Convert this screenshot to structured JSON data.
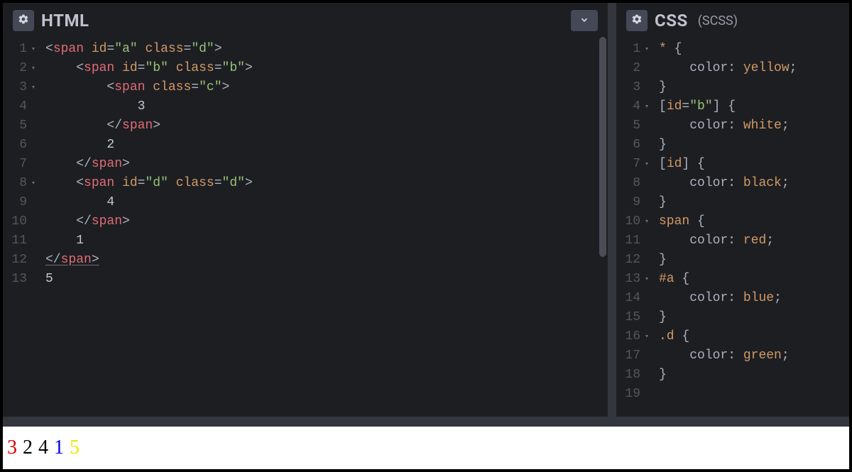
{
  "panels": {
    "html": {
      "title": "HTML",
      "subtitle": ""
    },
    "css": {
      "title": "CSS",
      "subtitle": "(SCSS)"
    }
  },
  "html_code": {
    "lines": [
      {
        "n": 1,
        "fold": true,
        "indent": 0,
        "tokens": [
          {
            "t": "<",
            "c": "punct"
          },
          {
            "t": "span",
            "c": "tag"
          },
          {
            "t": " ",
            "c": "plain"
          },
          {
            "t": "id",
            "c": "attrname"
          },
          {
            "t": "=",
            "c": "punct"
          },
          {
            "t": "\"a\"",
            "c": "attrvalue"
          },
          {
            "t": " ",
            "c": "plain"
          },
          {
            "t": "class",
            "c": "attrname"
          },
          {
            "t": "=",
            "c": "punct"
          },
          {
            "t": "\"d\"",
            "c": "attrvalue"
          },
          {
            "t": ">",
            "c": "punct"
          }
        ]
      },
      {
        "n": 2,
        "fold": true,
        "indent": 1,
        "tokens": [
          {
            "t": "<",
            "c": "punct"
          },
          {
            "t": "span",
            "c": "tag"
          },
          {
            "t": " ",
            "c": "plain"
          },
          {
            "t": "id",
            "c": "attrname"
          },
          {
            "t": "=",
            "c": "punct"
          },
          {
            "t": "\"b\"",
            "c": "attrvalue"
          },
          {
            "t": " ",
            "c": "plain"
          },
          {
            "t": "class",
            "c": "attrname"
          },
          {
            "t": "=",
            "c": "punct"
          },
          {
            "t": "\"b\"",
            "c": "attrvalue"
          },
          {
            "t": ">",
            "c": "punct"
          }
        ]
      },
      {
        "n": 3,
        "fold": true,
        "indent": 2,
        "tokens": [
          {
            "t": "<",
            "c": "punct"
          },
          {
            "t": "span",
            "c": "tag"
          },
          {
            "t": " ",
            "c": "plain"
          },
          {
            "t": "class",
            "c": "attrname"
          },
          {
            "t": "=",
            "c": "punct"
          },
          {
            "t": "\"c\"",
            "c": "attrvalue"
          },
          {
            "t": ">",
            "c": "punct"
          }
        ]
      },
      {
        "n": 4,
        "fold": false,
        "indent": 3,
        "tokens": [
          {
            "t": "3",
            "c": "plain"
          }
        ]
      },
      {
        "n": 5,
        "fold": false,
        "indent": 2,
        "tokens": [
          {
            "t": "</",
            "c": "punct"
          },
          {
            "t": "span",
            "c": "tag"
          },
          {
            "t": ">",
            "c": "punct"
          }
        ]
      },
      {
        "n": 6,
        "fold": false,
        "indent": 2,
        "tokens": [
          {
            "t": "2",
            "c": "plain"
          }
        ]
      },
      {
        "n": 7,
        "fold": false,
        "indent": 1,
        "tokens": [
          {
            "t": "</",
            "c": "punct"
          },
          {
            "t": "span",
            "c": "tag"
          },
          {
            "t": ">",
            "c": "punct"
          }
        ]
      },
      {
        "n": 8,
        "fold": true,
        "indent": 1,
        "tokens": [
          {
            "t": "<",
            "c": "punct"
          },
          {
            "t": "span",
            "c": "tag"
          },
          {
            "t": " ",
            "c": "plain"
          },
          {
            "t": "id",
            "c": "attrname"
          },
          {
            "t": "=",
            "c": "punct"
          },
          {
            "t": "\"d\"",
            "c": "attrvalue"
          },
          {
            "t": " ",
            "c": "plain"
          },
          {
            "t": "class",
            "c": "attrname"
          },
          {
            "t": "=",
            "c": "punct"
          },
          {
            "t": "\"d\"",
            "c": "attrvalue"
          },
          {
            "t": ">",
            "c": "punct"
          }
        ]
      },
      {
        "n": 9,
        "fold": false,
        "indent": 2,
        "tokens": [
          {
            "t": "4",
            "c": "plain"
          }
        ]
      },
      {
        "n": 10,
        "fold": false,
        "indent": 1,
        "tokens": [
          {
            "t": "</",
            "c": "punct"
          },
          {
            "t": "span",
            "c": "tag"
          },
          {
            "t": ">",
            "c": "punct"
          }
        ]
      },
      {
        "n": 11,
        "fold": false,
        "indent": 1,
        "tokens": [
          {
            "t": "1",
            "c": "plain"
          }
        ]
      },
      {
        "n": 12,
        "fold": false,
        "indent": 0,
        "underline": true,
        "tokens": [
          {
            "t": "</",
            "c": "punct"
          },
          {
            "t": "span",
            "c": "tag"
          },
          {
            "t": ">",
            "c": "punct"
          }
        ]
      },
      {
        "n": 13,
        "fold": false,
        "indent": 0,
        "tokens": [
          {
            "t": "5",
            "c": "plain"
          }
        ]
      }
    ]
  },
  "css_code": {
    "lines": [
      {
        "n": 1,
        "fold": true,
        "indent": 0,
        "tokens": [
          {
            "t": "*",
            "c": "selector"
          },
          {
            "t": " {",
            "c": "bracket"
          }
        ]
      },
      {
        "n": 2,
        "fold": false,
        "indent": 1,
        "tokens": [
          {
            "t": "color",
            "c": "prop"
          },
          {
            "t": ": ",
            "c": "punct"
          },
          {
            "t": "yellow",
            "c": "val-word"
          },
          {
            "t": ";",
            "c": "punct"
          }
        ]
      },
      {
        "n": 3,
        "fold": false,
        "indent": 0,
        "tokens": [
          {
            "t": "}",
            "c": "bracket"
          }
        ]
      },
      {
        "n": 4,
        "fold": true,
        "indent": 0,
        "tokens": [
          {
            "t": "[",
            "c": "bracket"
          },
          {
            "t": "id",
            "c": "selector"
          },
          {
            "t": "=",
            "c": "punct"
          },
          {
            "t": "\"b\"",
            "c": "attrvalue"
          },
          {
            "t": "]",
            "c": "bracket"
          },
          {
            "t": " {",
            "c": "bracket"
          }
        ]
      },
      {
        "n": 5,
        "fold": false,
        "indent": 1,
        "tokens": [
          {
            "t": "color",
            "c": "prop"
          },
          {
            "t": ": ",
            "c": "punct"
          },
          {
            "t": "white",
            "c": "val-word"
          },
          {
            "t": ";",
            "c": "punct"
          }
        ]
      },
      {
        "n": 6,
        "fold": false,
        "indent": 0,
        "tokens": [
          {
            "t": "}",
            "c": "bracket"
          }
        ]
      },
      {
        "n": 7,
        "fold": true,
        "indent": 0,
        "tokens": [
          {
            "t": "[",
            "c": "bracket"
          },
          {
            "t": "id",
            "c": "selector"
          },
          {
            "t": "]",
            "c": "bracket"
          },
          {
            "t": " {",
            "c": "bracket"
          }
        ]
      },
      {
        "n": 8,
        "fold": false,
        "indent": 1,
        "tokens": [
          {
            "t": "color",
            "c": "prop"
          },
          {
            "t": ": ",
            "c": "punct"
          },
          {
            "t": "black",
            "c": "val-word"
          },
          {
            "t": ";",
            "c": "punct"
          }
        ]
      },
      {
        "n": 9,
        "fold": false,
        "indent": 0,
        "tokens": [
          {
            "t": "}",
            "c": "bracket"
          }
        ]
      },
      {
        "n": 10,
        "fold": true,
        "indent": 0,
        "tokens": [
          {
            "t": "span",
            "c": "selector"
          },
          {
            "t": " {",
            "c": "bracket"
          }
        ]
      },
      {
        "n": 11,
        "fold": false,
        "indent": 1,
        "tokens": [
          {
            "t": "color",
            "c": "prop"
          },
          {
            "t": ": ",
            "c": "punct"
          },
          {
            "t": "red",
            "c": "val-word"
          },
          {
            "t": ";",
            "c": "punct"
          }
        ]
      },
      {
        "n": 12,
        "fold": false,
        "indent": 0,
        "tokens": [
          {
            "t": "}",
            "c": "bracket"
          }
        ]
      },
      {
        "n": 13,
        "fold": true,
        "indent": 0,
        "tokens": [
          {
            "t": "#a",
            "c": "selector"
          },
          {
            "t": " {",
            "c": "bracket"
          }
        ]
      },
      {
        "n": 14,
        "fold": false,
        "indent": 1,
        "tokens": [
          {
            "t": "color",
            "c": "prop"
          },
          {
            "t": ": ",
            "c": "punct"
          },
          {
            "t": "blue",
            "c": "val-word"
          },
          {
            "t": ";",
            "c": "punct"
          }
        ]
      },
      {
        "n": 15,
        "fold": false,
        "indent": 0,
        "tokens": [
          {
            "t": "}",
            "c": "bracket"
          }
        ]
      },
      {
        "n": 16,
        "fold": true,
        "indent": 0,
        "tokens": [
          {
            "t": ".d",
            "c": "selector"
          },
          {
            "t": " {",
            "c": "bracket"
          }
        ]
      },
      {
        "n": 17,
        "fold": false,
        "indent": 1,
        "tokens": [
          {
            "t": "color",
            "c": "prop"
          },
          {
            "t": ": ",
            "c": "punct"
          },
          {
            "t": "green",
            "c": "val-word"
          },
          {
            "t": ";",
            "c": "punct"
          }
        ]
      },
      {
        "n": 18,
        "fold": false,
        "indent": 0,
        "tokens": [
          {
            "t": "}",
            "c": "bracket"
          }
        ]
      },
      {
        "n": 19,
        "fold": false,
        "indent": 0,
        "tokens": []
      }
    ]
  },
  "output": [
    {
      "text": "3",
      "color": "#d90000"
    },
    {
      "text": "2",
      "color": "#000000"
    },
    {
      "text": "4",
      "color": "#000000"
    },
    {
      "text": "1",
      "color": "#0000ee"
    },
    {
      "text": "5",
      "color": "#f2e600"
    }
  ]
}
